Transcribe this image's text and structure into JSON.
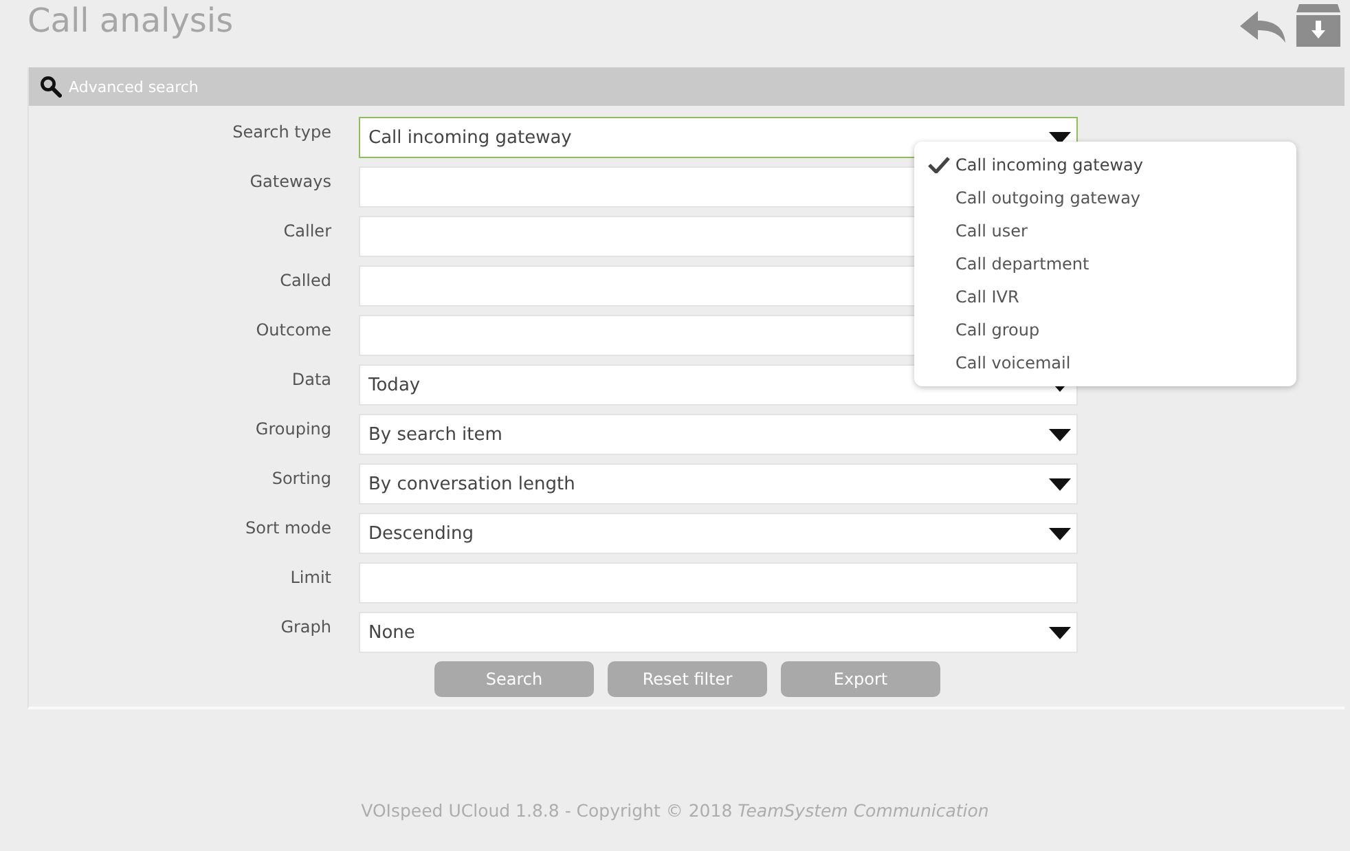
{
  "page_title": "Call analysis",
  "panel": {
    "title": "Advanced search"
  },
  "fields": [
    {
      "label": "Search type",
      "kind": "select",
      "value": "Call incoming gateway",
      "open": true
    },
    {
      "label": "Gateways",
      "kind": "text"
    },
    {
      "label": "Caller",
      "kind": "text"
    },
    {
      "label": "Called",
      "kind": "text"
    },
    {
      "label": "Outcome",
      "kind": "text"
    },
    {
      "label": "Data",
      "kind": "select",
      "value": "Today",
      "open": false
    },
    {
      "label": "Grouping",
      "kind": "select",
      "value": "By search item",
      "open": false
    },
    {
      "label": "Sorting",
      "kind": "select",
      "value": "By conversation length",
      "open": false
    },
    {
      "label": "Sort mode",
      "kind": "select",
      "value": "Descending",
      "open": false
    },
    {
      "label": "Limit",
      "kind": "text"
    },
    {
      "label": "Graph",
      "kind": "select",
      "value": "None",
      "open": false
    }
  ],
  "dropdown_options": [
    {
      "label": "Call incoming gateway",
      "selected": true
    },
    {
      "label": "Call outgoing gateway",
      "selected": false
    },
    {
      "label": "Call user",
      "selected": false
    },
    {
      "label": "Call department",
      "selected": false
    },
    {
      "label": "Call IVR",
      "selected": false
    },
    {
      "label": "Call group",
      "selected": false
    },
    {
      "label": "Call voicemail",
      "selected": false
    }
  ],
  "buttons": [
    "Search",
    "Reset filter",
    "Export"
  ],
  "footer": "VOIspeed UCloud 1.8.8 - Copyright © 2018 *TeamSystem Communication*"
}
